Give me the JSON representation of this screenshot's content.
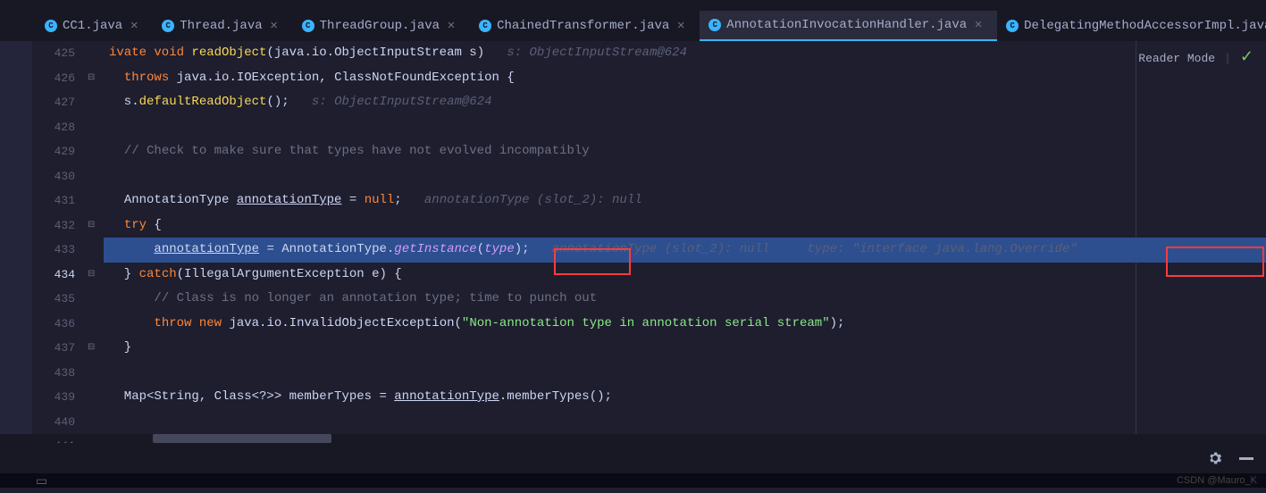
{
  "tabs": [
    {
      "label": "CC1.java"
    },
    {
      "label": "Thread.java"
    },
    {
      "label": "ThreadGroup.java"
    },
    {
      "label": "ChainedTransformer.java"
    },
    {
      "label": "AnnotationInvocationHandler.java",
      "active": true
    },
    {
      "label": "DelegatingMethodAccessorImpl.java"
    }
  ],
  "rightpanel": {
    "mode": "Reader Mode"
  },
  "gutter": {
    "start": 425,
    "end": 441,
    "active": 434
  },
  "code": {
    "lines": [
      {
        "n": 425,
        "segs": [
          {
            "t": "ivate void ",
            "c": "kw"
          },
          {
            "t": "readObject",
            "c": "fn"
          },
          {
            "t": "(java.io.",
            "c": "type"
          },
          {
            "t": "ObjectInputStream",
            "c": "type"
          },
          {
            "t": " s)   ",
            "c": "var"
          },
          {
            "t": "s: ObjectInputStream@624",
            "c": "hint"
          }
        ],
        "at": true
      },
      {
        "n": 426,
        "segs": [
          {
            "t": "  ",
            "c": ""
          },
          {
            "t": "throws",
            "c": "kw"
          },
          {
            "t": " java.io.",
            "c": "type"
          },
          {
            "t": "IOException",
            "c": "type"
          },
          {
            "t": ", ",
            "c": "var"
          },
          {
            "t": "ClassNotFoundException",
            "c": "type"
          },
          {
            "t": " {",
            "c": "paren"
          }
        ],
        "fold": "-"
      },
      {
        "n": 427,
        "segs": [
          {
            "t": "  s.",
            "c": "var"
          },
          {
            "t": "defaultReadObject",
            "c": "fn"
          },
          {
            "t": "();   ",
            "c": "paren"
          },
          {
            "t": "s: ObjectInputStream@624",
            "c": "hint"
          }
        ]
      },
      {
        "n": 428,
        "segs": [
          {
            "t": "",
            "c": ""
          }
        ]
      },
      {
        "n": 429,
        "segs": [
          {
            "t": "  ",
            "c": ""
          },
          {
            "t": "// Check to make sure that types have not evolved incompatibly",
            "c": "cmt"
          }
        ]
      },
      {
        "n": 430,
        "segs": [
          {
            "t": "",
            "c": ""
          }
        ]
      },
      {
        "n": 431,
        "segs": [
          {
            "t": "  ",
            "c": ""
          },
          {
            "t": "AnnotationType",
            "c": "type"
          },
          {
            "t": " ",
            "c": ""
          },
          {
            "t": "annotationType",
            "c": "uvar"
          },
          {
            "t": " = ",
            "c": "var"
          },
          {
            "t": "null",
            "c": "kw"
          },
          {
            "t": ";   ",
            "c": "var"
          },
          {
            "t": "annotationType (slot_2): null",
            "c": "hint"
          }
        ]
      },
      {
        "n": 432,
        "segs": [
          {
            "t": "  ",
            "c": ""
          },
          {
            "t": "try",
            "c": "kw"
          },
          {
            "t": " {",
            "c": "paren"
          }
        ],
        "fold": "-"
      },
      {
        "n": 433,
        "hl": true,
        "bp": true,
        "segs": [
          {
            "t": "      ",
            "c": ""
          },
          {
            "t": "annotationType",
            "c": "uvar"
          },
          {
            "t": " = ",
            "c": "var"
          },
          {
            "t": "AnnotationType",
            "c": "type"
          },
          {
            "t": ".",
            "c": "var"
          },
          {
            "t": "getInstance",
            "c": "fn param"
          },
          {
            "t": "(",
            "c": "paren"
          },
          {
            "t": "type",
            "c": "param"
          },
          {
            "t": ");   ",
            "c": "paren"
          },
          {
            "t": "annotationType (slot_2): null     type: \"interface java.lang.Override\"",
            "c": "hint"
          }
        ]
      },
      {
        "n": 434,
        "segs": [
          {
            "t": "  } ",
            "c": "paren"
          },
          {
            "t": "catch",
            "c": "kw"
          },
          {
            "t": "(",
            "c": "paren"
          },
          {
            "t": "IllegalArgumentException",
            "c": "type"
          },
          {
            "t": " e) {",
            "c": "paren"
          }
        ],
        "fold": "-"
      },
      {
        "n": 435,
        "segs": [
          {
            "t": "      ",
            "c": ""
          },
          {
            "t": "// Class is no longer an annotation type; time to punch out",
            "c": "cmt"
          }
        ]
      },
      {
        "n": 436,
        "segs": [
          {
            "t": "      ",
            "c": ""
          },
          {
            "t": "throw new",
            "c": "kw"
          },
          {
            "t": " java.io.",
            "c": "type"
          },
          {
            "t": "InvalidObjectException",
            "c": "type"
          },
          {
            "t": "(",
            "c": "paren"
          },
          {
            "t": "\"Non-annotation type in annotation serial stream\"",
            "c": "str"
          },
          {
            "t": ");",
            "c": "paren"
          }
        ]
      },
      {
        "n": 437,
        "segs": [
          {
            "t": "  }",
            "c": "paren"
          }
        ],
        "fold": "-"
      },
      {
        "n": 438,
        "segs": [
          {
            "t": "",
            "c": ""
          }
        ]
      },
      {
        "n": 439,
        "segs": [
          {
            "t": "  Map<String, Class<?>> memberTypes = ",
            "c": "var"
          },
          {
            "t": "annotationType",
            "c": "uvar"
          },
          {
            "t": ".memberTypes();",
            "c": "var"
          }
        ]
      },
      {
        "n": 440,
        "segs": [
          {
            "t": "",
            "c": ""
          }
        ]
      }
    ]
  },
  "watermark": "CSDN @Mauro_K"
}
